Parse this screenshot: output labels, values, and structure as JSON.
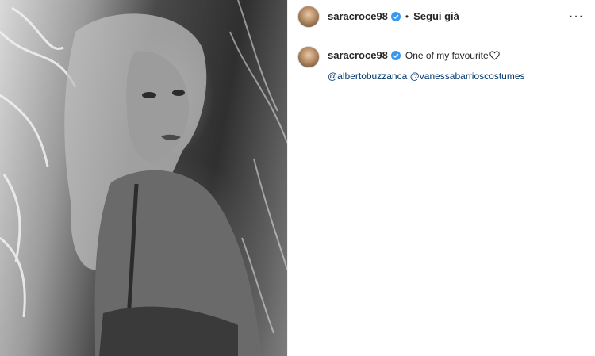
{
  "header": {
    "username": "saracroce98",
    "separator": "•",
    "follow_state": "Segui già",
    "more_label": "···"
  },
  "caption": {
    "username": "saracroce98",
    "text": "One of my favourite",
    "mentions": [
      "@albertobuzzanca",
      "@vanessabarrioscostumes"
    ]
  },
  "colors": {
    "verified": "#3897f0",
    "link": "#00376b",
    "text": "#262626",
    "divider": "#efefef"
  },
  "icons": {
    "verified": "verified-badge-icon",
    "heart": "heart-outline-icon",
    "more": "more-options-icon"
  }
}
